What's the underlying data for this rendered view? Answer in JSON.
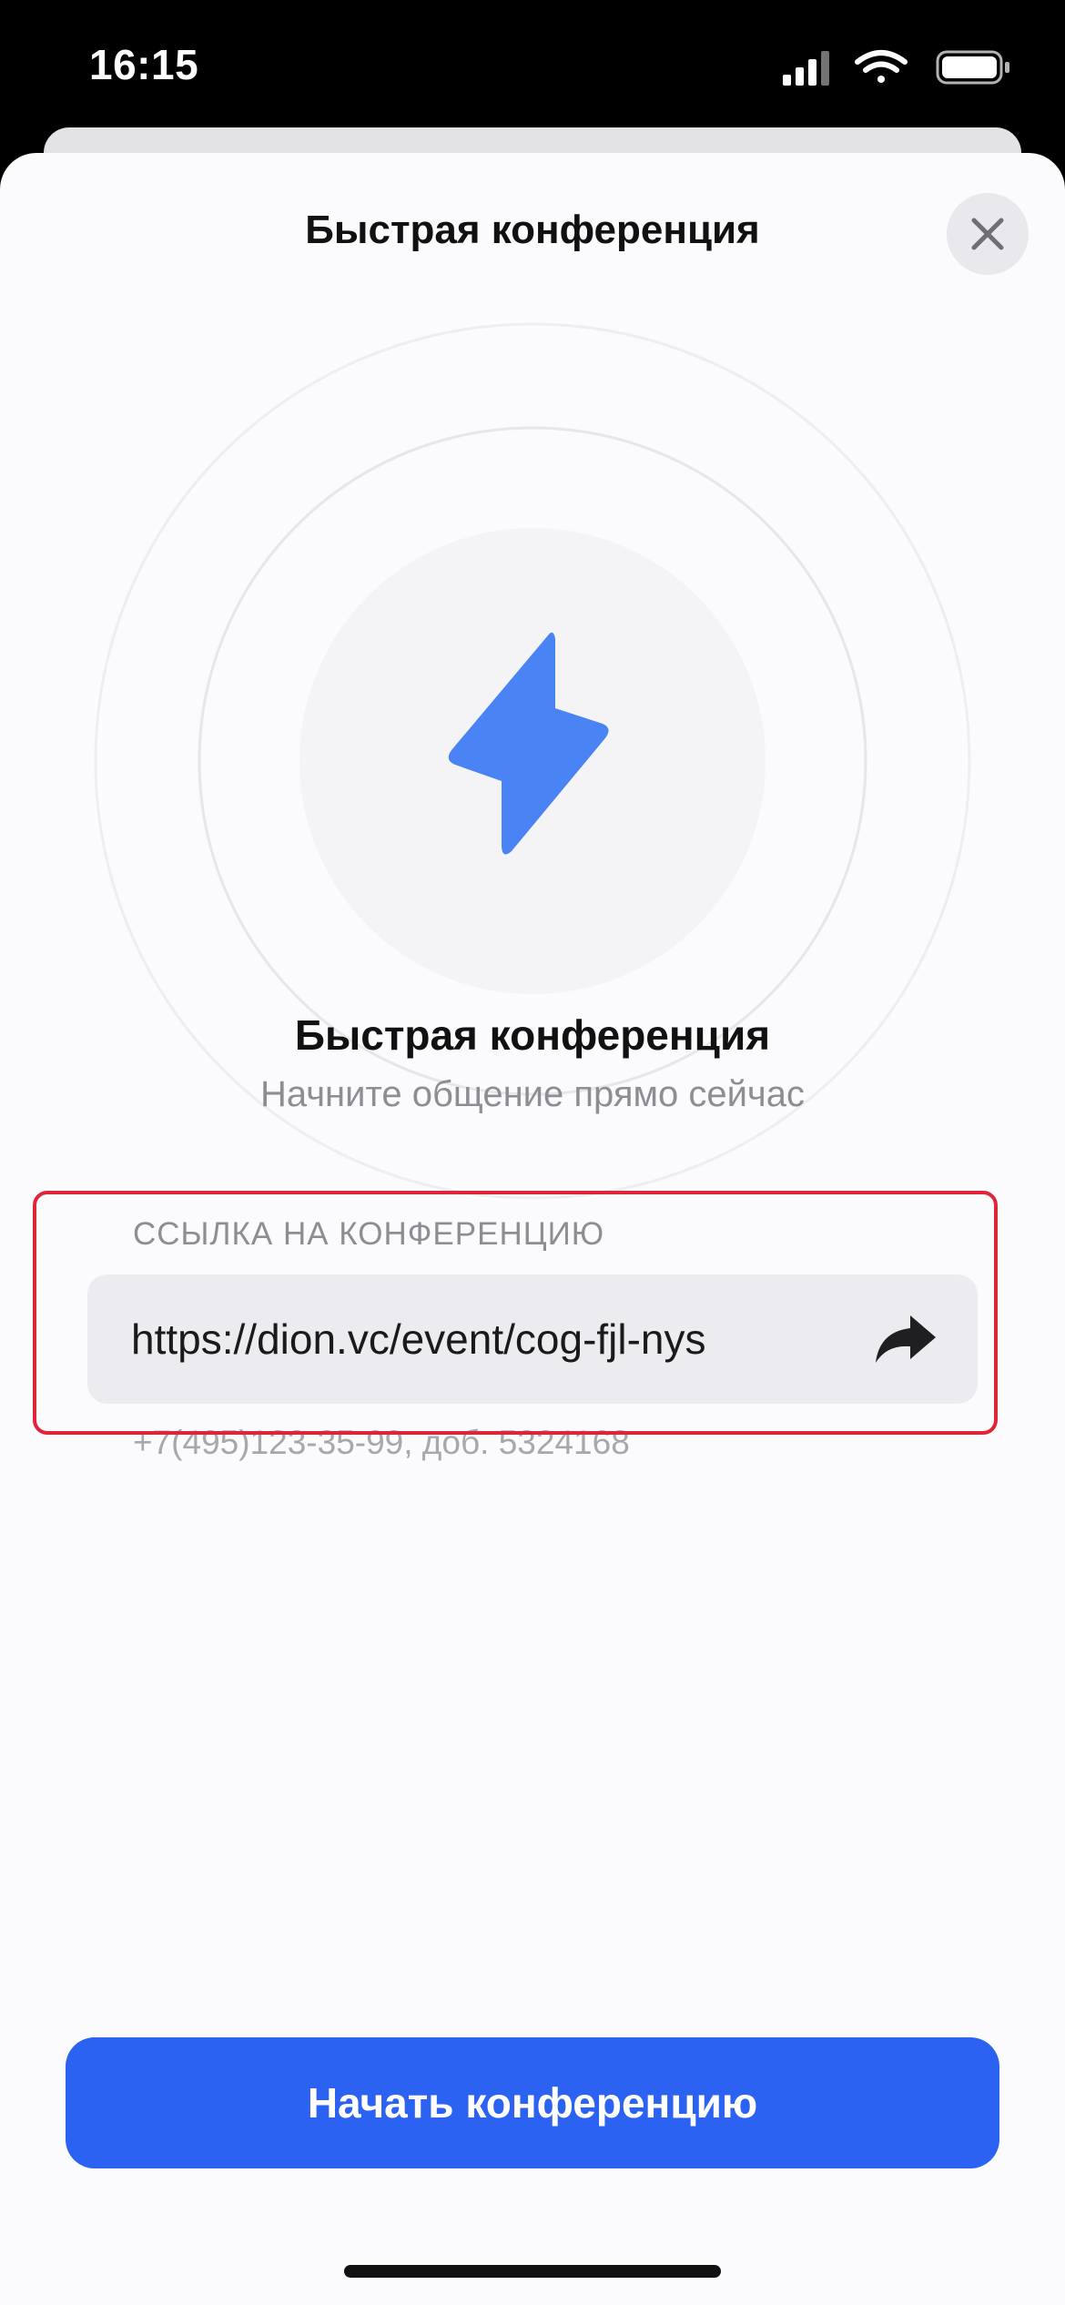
{
  "status_bar": {
    "time": "16:15"
  },
  "sheet": {
    "title": "Быстрая конференция",
    "close_icon": "close-icon"
  },
  "hero": {
    "icon": "lightning-icon",
    "title": "Быстрая конференция",
    "subtitle": "Начните общение прямо сейчас"
  },
  "link_section": {
    "label": "ССЫЛКА НА КОНФЕРЕНЦИЮ",
    "url": "https://dion.vc/event/cog-fjl-nys",
    "share_icon": "share-arrow-icon",
    "phone": "+7(495)123-35-99, доб. 5324168"
  },
  "actions": {
    "start_label": "Начать конференцию"
  },
  "colors": {
    "accent": "#2c62f2",
    "icon_blue": "#4a83f3",
    "highlight": "#e0243a"
  }
}
